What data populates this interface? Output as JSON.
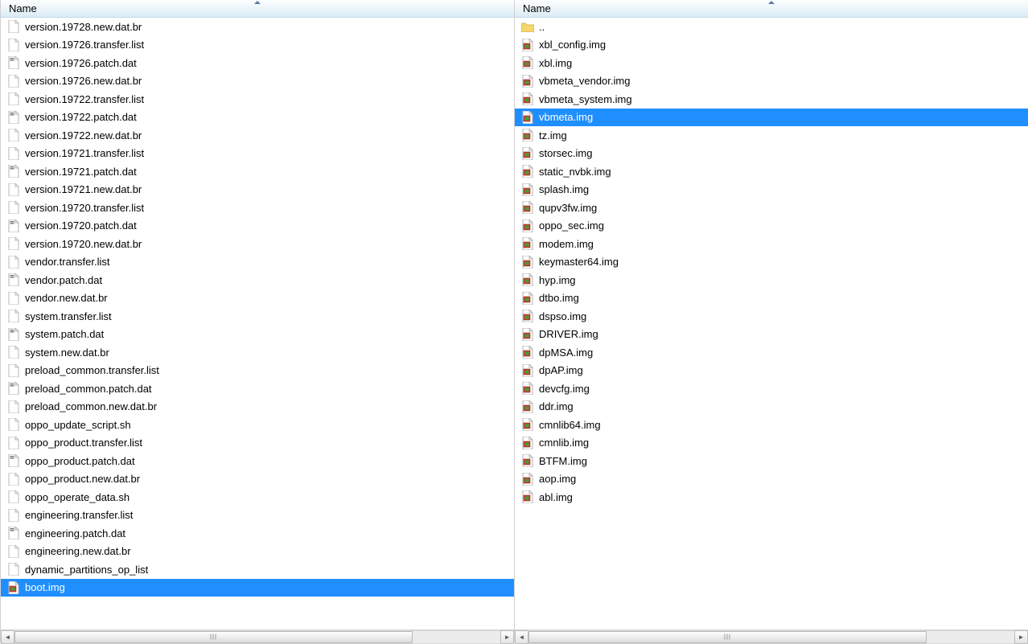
{
  "left": {
    "header": "Name",
    "files": [
      {
        "name": "version.19728.new.dat.br",
        "icon": "file",
        "selected": false
      },
      {
        "name": "version.19726.transfer.list",
        "icon": "file",
        "selected": false
      },
      {
        "name": "version.19726.patch.dat",
        "icon": "patch",
        "selected": false
      },
      {
        "name": "version.19726.new.dat.br",
        "icon": "file",
        "selected": false
      },
      {
        "name": "version.19722.transfer.list",
        "icon": "file",
        "selected": false
      },
      {
        "name": "version.19722.patch.dat",
        "icon": "patch",
        "selected": false
      },
      {
        "name": "version.19722.new.dat.br",
        "icon": "file",
        "selected": false
      },
      {
        "name": "version.19721.transfer.list",
        "icon": "file",
        "selected": false
      },
      {
        "name": "version.19721.patch.dat",
        "icon": "patch",
        "selected": false
      },
      {
        "name": "version.19721.new.dat.br",
        "icon": "file",
        "selected": false
      },
      {
        "name": "version.19720.transfer.list",
        "icon": "file",
        "selected": false
      },
      {
        "name": "version.19720.patch.dat",
        "icon": "patch",
        "selected": false
      },
      {
        "name": "version.19720.new.dat.br",
        "icon": "file",
        "selected": false
      },
      {
        "name": "vendor.transfer.list",
        "icon": "file",
        "selected": false
      },
      {
        "name": "vendor.patch.dat",
        "icon": "patch",
        "selected": false
      },
      {
        "name": "vendor.new.dat.br",
        "icon": "file",
        "selected": false
      },
      {
        "name": "system.transfer.list",
        "icon": "file",
        "selected": false
      },
      {
        "name": "system.patch.dat",
        "icon": "patch",
        "selected": false
      },
      {
        "name": "system.new.dat.br",
        "icon": "file",
        "selected": false
      },
      {
        "name": "preload_common.transfer.list",
        "icon": "file",
        "selected": false
      },
      {
        "name": "preload_common.patch.dat",
        "icon": "patch",
        "selected": false
      },
      {
        "name": "preload_common.new.dat.br",
        "icon": "file",
        "selected": false
      },
      {
        "name": "oppo_update_script.sh",
        "icon": "file",
        "selected": false
      },
      {
        "name": "oppo_product.transfer.list",
        "icon": "file",
        "selected": false
      },
      {
        "name": "oppo_product.patch.dat",
        "icon": "patch",
        "selected": false
      },
      {
        "name": "oppo_product.new.dat.br",
        "icon": "file",
        "selected": false
      },
      {
        "name": "oppo_operate_data.sh",
        "icon": "file",
        "selected": false
      },
      {
        "name": "engineering.transfer.list",
        "icon": "file",
        "selected": false
      },
      {
        "name": "engineering.patch.dat",
        "icon": "patch",
        "selected": false
      },
      {
        "name": "engineering.new.dat.br",
        "icon": "file",
        "selected": false
      },
      {
        "name": "dynamic_partitions_op_list",
        "icon": "file",
        "selected": false
      },
      {
        "name": "boot.img",
        "icon": "img",
        "selected": true
      }
    ],
    "thumbWidthPct": 82
  },
  "right": {
    "header": "Name",
    "files": [
      {
        "name": "..",
        "icon": "folder",
        "selected": false
      },
      {
        "name": "xbl_config.img",
        "icon": "img",
        "selected": false
      },
      {
        "name": "xbl.img",
        "icon": "img",
        "selected": false
      },
      {
        "name": "vbmeta_vendor.img",
        "icon": "img",
        "selected": false
      },
      {
        "name": "vbmeta_system.img",
        "icon": "img",
        "selected": false
      },
      {
        "name": "vbmeta.img",
        "icon": "img",
        "selected": true
      },
      {
        "name": "tz.img",
        "icon": "img",
        "selected": false
      },
      {
        "name": "storsec.img",
        "icon": "img",
        "selected": false
      },
      {
        "name": "static_nvbk.img",
        "icon": "img",
        "selected": false
      },
      {
        "name": "splash.img",
        "icon": "img",
        "selected": false
      },
      {
        "name": "qupv3fw.img",
        "icon": "img",
        "selected": false
      },
      {
        "name": "oppo_sec.img",
        "icon": "img",
        "selected": false
      },
      {
        "name": "modem.img",
        "icon": "img",
        "selected": false
      },
      {
        "name": "keymaster64.img",
        "icon": "img",
        "selected": false
      },
      {
        "name": "hyp.img",
        "icon": "img",
        "selected": false
      },
      {
        "name": "dtbo.img",
        "icon": "img",
        "selected": false
      },
      {
        "name": "dspso.img",
        "icon": "img",
        "selected": false
      },
      {
        "name": "DRIVER.img",
        "icon": "img",
        "selected": false
      },
      {
        "name": "dpMSA.img",
        "icon": "img",
        "selected": false
      },
      {
        "name": "dpAP.img",
        "icon": "img",
        "selected": false
      },
      {
        "name": "devcfg.img",
        "icon": "img",
        "selected": false
      },
      {
        "name": "ddr.img",
        "icon": "img",
        "selected": false
      },
      {
        "name": "cmnlib64.img",
        "icon": "img",
        "selected": false
      },
      {
        "name": "cmnlib.img",
        "icon": "img",
        "selected": false
      },
      {
        "name": "BTFM.img",
        "icon": "img",
        "selected": false
      },
      {
        "name": "aop.img",
        "icon": "img",
        "selected": false
      },
      {
        "name": "abl.img",
        "icon": "img",
        "selected": false
      }
    ],
    "thumbWidthPct": 82
  }
}
